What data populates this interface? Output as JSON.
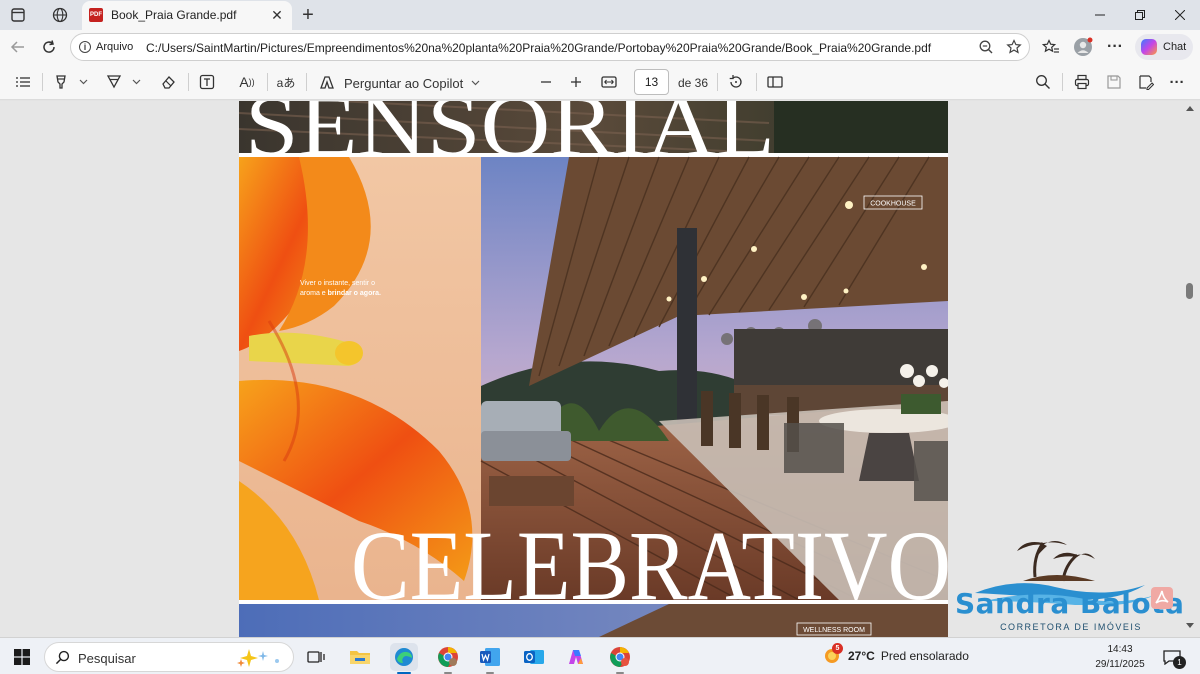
{
  "browser": {
    "tab_title": "Book_Praia Grande.pdf",
    "tab_close": "✕",
    "new_tab": "+",
    "address_scheme": "Arquivo",
    "address_url": "C:/Users/SaintMartin/Pictures/Empreendimentos%20na%20planta%20Praia%20Grande/Portobay%20Praia%20Grande/Book_Praia%20Grande.pdf",
    "chat_label": "Chat"
  },
  "pdf_toolbar": {
    "copilot_label": "Perguntar ao Copilot",
    "page_current": "13",
    "page_total": "de 36",
    "read_aloud_glyph": "A",
    "translate_glyph": "aあ"
  },
  "pdf_page": {
    "top_word": "SENSORIAL",
    "bottom_word": "CELEBRATIVO",
    "flower_caption_line1": "Viver o instante, sentir o",
    "flower_caption_line2_a": "aroma e ",
    "flower_caption_line2_b": "brindar o agora.",
    "label_cookhouse": "COOKHOUSE",
    "label_wellness": "WELLNESS ROOM"
  },
  "watermark": {
    "name": "Sandra Balota",
    "subtitle": "CORRETORA DE IMÓVEIS",
    "color": "#2a8fd0"
  },
  "taskbar": {
    "search_label": "Pesquisar",
    "weather_temp": "27°C",
    "weather_text": "Pred ensolarado",
    "weather_badge": "5",
    "clock_time": "14:43",
    "clock_date": "29/11/2025",
    "notification_count": "1"
  },
  "colors": {
    "accent": "#0067c0",
    "pdf_red": "#c5221f"
  }
}
